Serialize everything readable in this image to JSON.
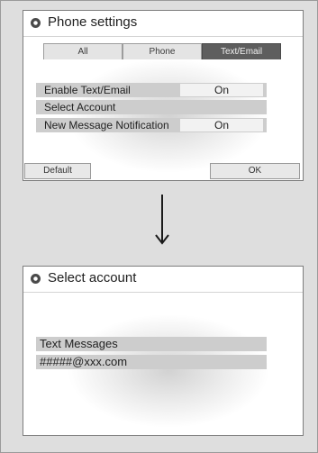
{
  "screen1": {
    "title": "Phone settings",
    "title_icon": "settings-gear-icon",
    "tabs": [
      {
        "label": "All",
        "active": false
      },
      {
        "label": "Phone",
        "active": false
      },
      {
        "label": "Text/Email",
        "active": true
      }
    ],
    "rows": [
      {
        "label": "Enable Text/Email",
        "value": "On"
      },
      {
        "label": "Select Account",
        "value": ""
      },
      {
        "label": "New Message Notification",
        "value": "On"
      }
    ],
    "buttons": {
      "default": "Default",
      "ok": "OK"
    }
  },
  "arrow_icon": "arrow-down-icon",
  "screen2": {
    "title": "Select account",
    "title_icon": "settings-gear-icon",
    "items": [
      {
        "label": "Text Messages"
      },
      {
        "label": "#####@xxx.com"
      }
    ]
  }
}
